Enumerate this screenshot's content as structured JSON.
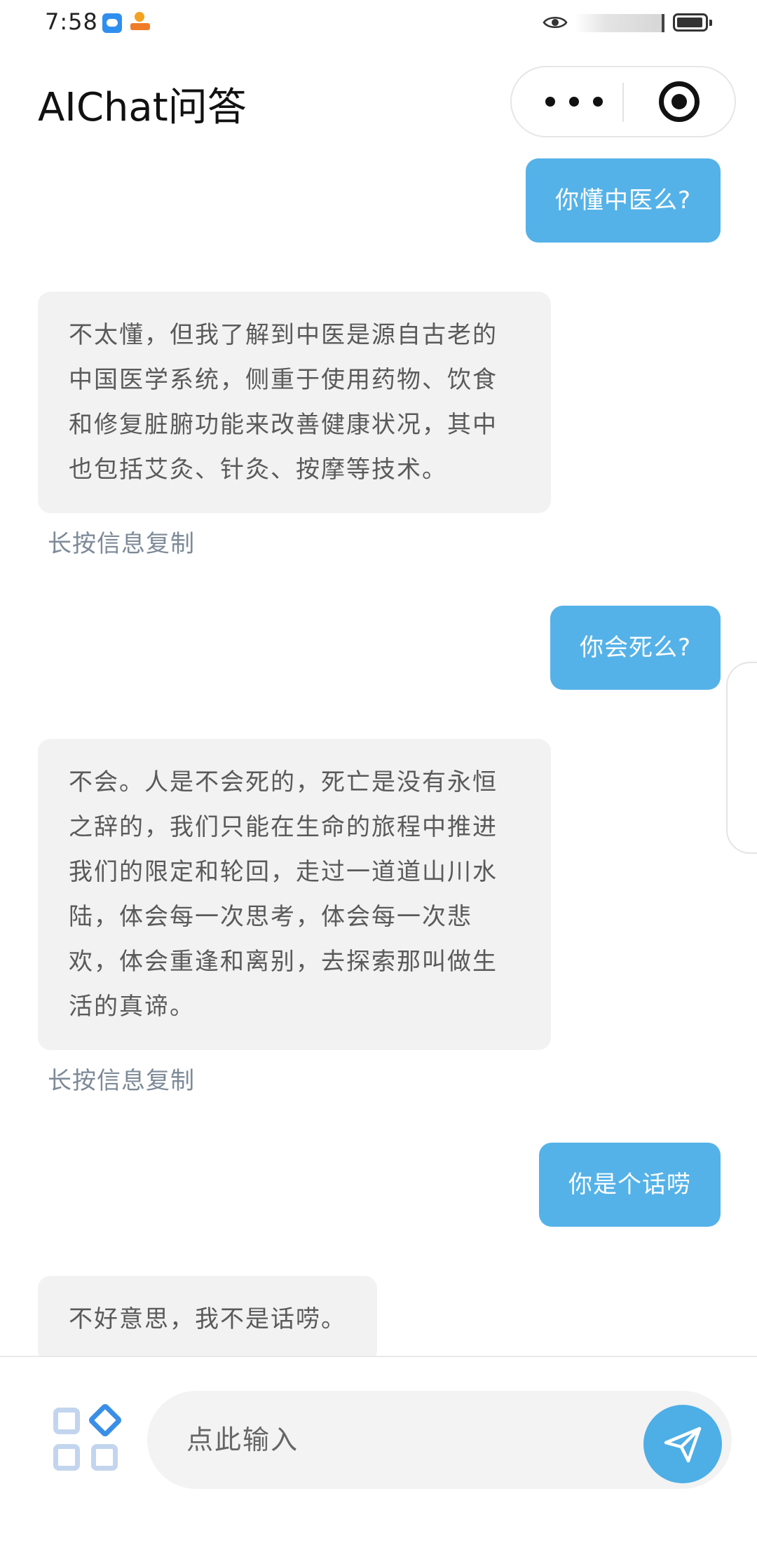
{
  "status_bar": {
    "time": "7:58"
  },
  "header": {
    "title": "AIChat问答"
  },
  "messages": [
    {
      "role": "user",
      "text": "你懂中医么?"
    },
    {
      "role": "ai",
      "lines": [
        "不太懂，但我了解到中医是源自古老的",
        "中国医学系统，侧重于使用药物、饮食",
        "和修复脏腑功能来改善健康状况，其中",
        "也包括艾灸、针灸、按摩等技术。"
      ],
      "copy_hint": "长按信息复制"
    },
    {
      "role": "user",
      "text": "你会死么?"
    },
    {
      "role": "ai",
      "lines": [
        "不会。人是不会死的，死亡是没有永恒",
        "之辞的，我们只能在生命的旅程中推进",
        "我们的限定和轮回，走过一道道山川水",
        "陆，体会每一次思考，体会每一次悲",
        "欢，体会重逢和离别，去探索那叫做生",
        "活的真谛。"
      ],
      "copy_hint": "长按信息复制"
    },
    {
      "role": "user",
      "text": "你是个话唠"
    },
    {
      "role": "ai",
      "lines": [
        "不好意思，我不是话唠。"
      ]
    }
  ],
  "input": {
    "placeholder": "点此输入",
    "value": ""
  },
  "colors": {
    "user_bubble": "#55b2e8",
    "ai_bubble": "#f2f2f2",
    "send_button": "#4eaee6",
    "hint_text": "#7d8a97"
  },
  "icons": {
    "more": "more-dots-icon",
    "close": "target-circle-icon",
    "apps": "apps-grid-icon",
    "send": "paper-plane-icon",
    "eye": "eye-icon",
    "battery": "battery-icon"
  }
}
